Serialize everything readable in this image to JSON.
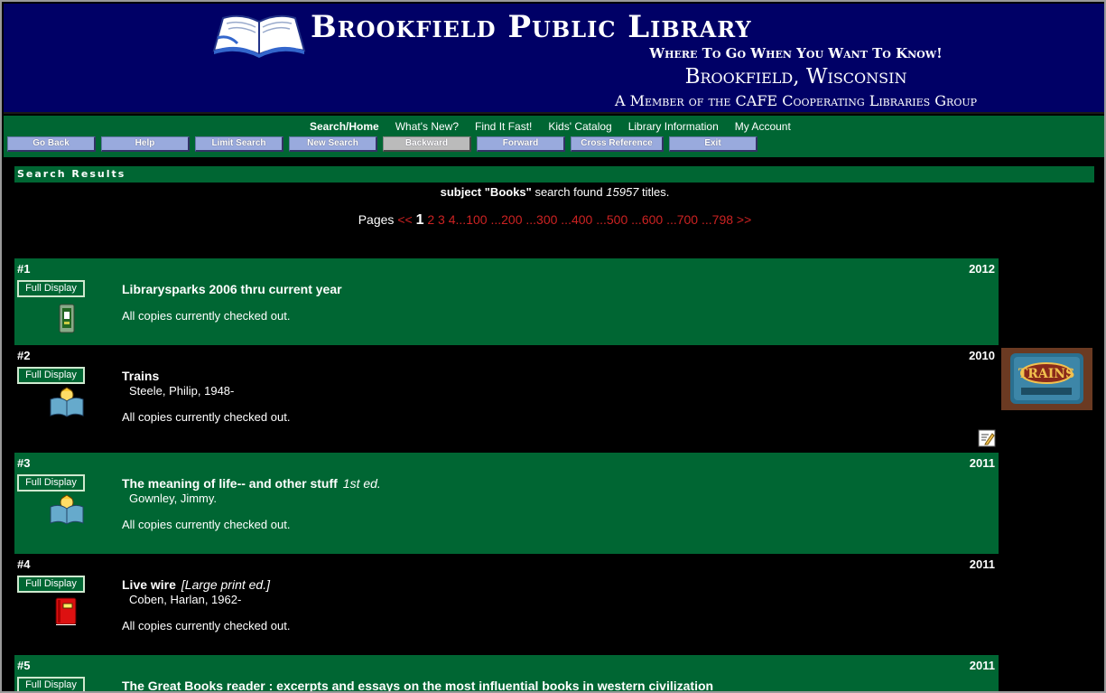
{
  "header": {
    "title": "Brookfield Public Library",
    "tagline": "Where To Go When You Want To Know!",
    "city": "Brookfield, Wisconsin",
    "member": "A Member of the CAFE Cooperating Libraries Group",
    "logo_icon": "open-book-icon"
  },
  "nav": {
    "links": [
      "Search/Home",
      "What's New?",
      "Find It Fast!",
      "Kids' Catalog",
      "Library Information",
      "My Account"
    ],
    "buttons": [
      "Go Back",
      "Help",
      "Limit Search",
      "New Search",
      "Backward",
      "Forward",
      "Cross Reference",
      "Exit"
    ]
  },
  "results": {
    "bar_label": "Search Results",
    "summary_prefix": "subject",
    "summary_query": "\"Books\"",
    "summary_mid": "search found",
    "summary_count": "15957",
    "summary_suffix": "titles."
  },
  "pager": {
    "label": "Pages",
    "prev": "<<",
    "current": "1",
    "pages": [
      "2",
      "3",
      "4"
    ],
    "ranges": [
      "100",
      "200",
      "300",
      "400",
      "500",
      "600",
      "700",
      "798"
    ],
    "range_prefix": "...",
    "next": ">>"
  },
  "full_display_label": "Full Display",
  "records": [
    {
      "num": "#1",
      "year": "2012",
      "title": "Librarysparks 2006 thru current year",
      "edition": "",
      "author": "",
      "availability": "All copies currently checked out.",
      "icon": "periodical-icon"
    },
    {
      "num": "#2",
      "year": "2010",
      "title": "Trains",
      "edition": "",
      "author": "Steele, Philip, 1948-",
      "availability": "All copies currently checked out.",
      "icon": "juvenile-book-icon"
    },
    {
      "num": "#3",
      "year": "2011",
      "title": "The meaning of life-- and other stuff",
      "edition": "1st ed.",
      "author": "Gownley, Jimmy.",
      "availability": "All copies currently checked out.",
      "icon": "juvenile-book-icon"
    },
    {
      "num": "#4",
      "year": "2011",
      "title": "Live wire",
      "edition": "[Large print ed.]",
      "author": "Coben, Harlan, 1962-",
      "availability": "All copies currently checked out.",
      "icon": "large-print-book-icon"
    },
    {
      "num": "#5",
      "year": "2011",
      "title": "The Great Books reader : excerpts and essays on the most influential books in western civilization",
      "edition": "",
      "author": "",
      "availability": "",
      "icon": ""
    }
  ],
  "cover": {
    "text": "TRAINS"
  },
  "colors": {
    "header_bg": "#000066",
    "nav_bg": "#006633",
    "record_bg": "#006633",
    "link_red": "#cc2222",
    "button_blue": "#99aadd"
  }
}
